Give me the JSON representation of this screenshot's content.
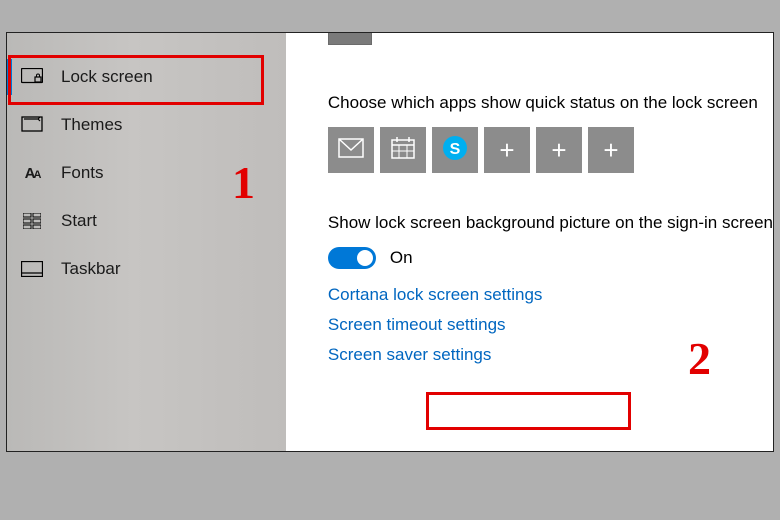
{
  "sidebar": {
    "items": [
      {
        "label": "Lock screen",
        "icon": "lock-screen-icon",
        "selected": true
      },
      {
        "label": "Themes",
        "icon": "themes-icon",
        "selected": false
      },
      {
        "label": "Fonts",
        "icon": "fonts-icon",
        "selected": false
      },
      {
        "label": "Start",
        "icon": "start-icon",
        "selected": false
      },
      {
        "label": "Taskbar",
        "icon": "taskbar-icon",
        "selected": false
      }
    ]
  },
  "main": {
    "quick_status_label": "Choose which apps show quick status on the lock screen",
    "tiles": [
      {
        "kind": "app",
        "icon": "mail-icon"
      },
      {
        "kind": "app",
        "icon": "calendar-icon"
      },
      {
        "kind": "app",
        "icon": "skype-icon"
      },
      {
        "kind": "add",
        "icon": "plus-icon"
      },
      {
        "kind": "add",
        "icon": "plus-icon"
      },
      {
        "kind": "add",
        "icon": "plus-icon"
      }
    ],
    "bg_picture_label": "Show lock screen background picture on the sign-in screen",
    "toggle": {
      "state": "On"
    },
    "links": {
      "cortana": "Cortana lock screen settings",
      "timeout": "Screen timeout settings",
      "saver": "Screen saver settings"
    }
  },
  "annotations": {
    "num1": "1",
    "num2": "2"
  },
  "colors": {
    "accent": "#0078d7",
    "link": "#0066c0",
    "annot": "#e20000"
  }
}
